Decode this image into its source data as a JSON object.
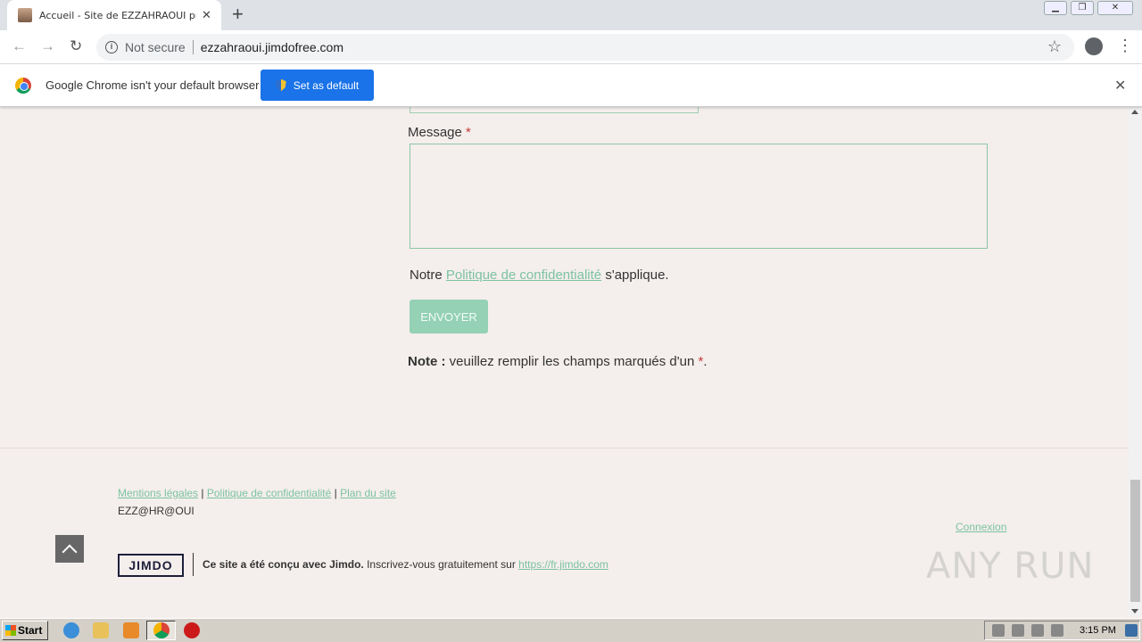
{
  "browser": {
    "tab_title": "Accueil - Site de EZZAHRAOUI prof d",
    "security_label": "Not secure",
    "url": "ezzahraoui.jimdofree.com"
  },
  "infobar": {
    "message": "Google Chrome isn't your default browser",
    "button_label": "Set as default"
  },
  "form": {
    "message_label": "Message",
    "required_mark": "*",
    "privacy_prefix": "Notre",
    "privacy_link": "Politique de confidentialité",
    "privacy_suffix": "s'applique.",
    "send_label": "ENVOYER",
    "note_bold": "Note :",
    "note_text": "veuillez remplir les champs marqués d'un",
    "note_end": "."
  },
  "footer": {
    "links": [
      "Mentions légales",
      "Politique de confidentialité",
      "Plan du site"
    ],
    "separator": "|",
    "site_name": "EZZ@HR@OUI",
    "login_label": "Connexion",
    "jimdo_logo": "JIMDO",
    "jimdo_bold": "Ce site a été conçu avec Jimdo.",
    "jimdo_text": "Inscrivez-vous gratuitement sur",
    "jimdo_link": "https://fr.jimdo.com"
  },
  "watermark": "ANY RUN",
  "taskbar": {
    "start_label": "Start",
    "time": "3:15 PM"
  },
  "colors": {
    "accent": "#94d1b5",
    "link": "#7cc3a1",
    "required": "#c53a3a",
    "background": "#f4eeec"
  }
}
